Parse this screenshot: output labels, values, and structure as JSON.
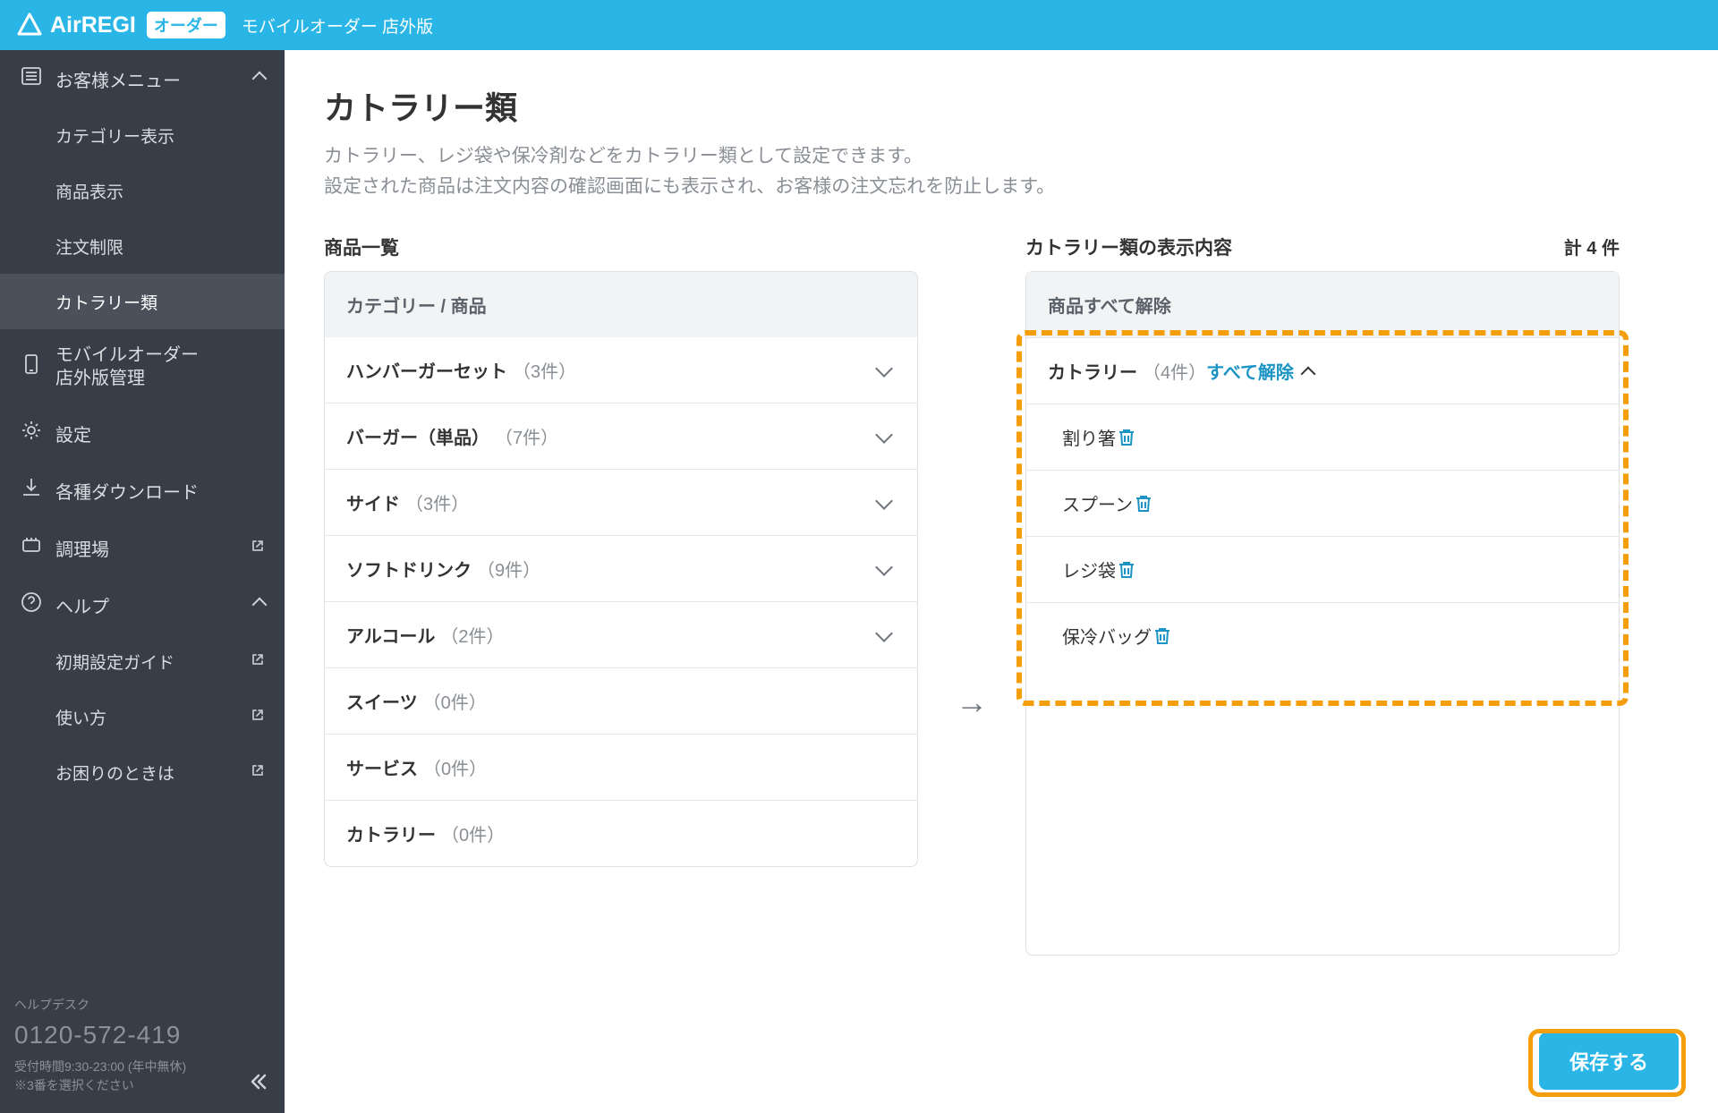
{
  "header": {
    "logo_text": "AirREGI",
    "logo_badge": "オーダー",
    "subtitle": "モバイルオーダー 店外版"
  },
  "sidebar": {
    "items": [
      {
        "label": "お客様メニュー",
        "icon": "menu-icon",
        "expandable": true
      },
      {
        "label": "カテゴリー表示",
        "sub": true
      },
      {
        "label": "商品表示",
        "sub": true
      },
      {
        "label": "注文制限",
        "sub": true
      },
      {
        "label": "カトラリー類",
        "sub": true,
        "active": true
      },
      {
        "label": "モバイルオーダー店外版管理",
        "icon": "mobile-icon",
        "multiline": true
      },
      {
        "label": "設定",
        "icon": "gear-icon"
      },
      {
        "label": "各種ダウンロード",
        "icon": "download-icon"
      },
      {
        "label": "調理場",
        "icon": "kitchen-icon",
        "ext": true
      },
      {
        "label": "ヘルプ",
        "icon": "help-icon",
        "expandable": true
      },
      {
        "label": "初期設定ガイド",
        "sub": true,
        "ext": true
      },
      {
        "label": "使い方",
        "sub": true,
        "ext": true
      },
      {
        "label": "お困りのときは",
        "sub": true,
        "ext": true
      }
    ],
    "footer": {
      "desk_label": "ヘルプデスク",
      "phone": "0120-572-419",
      "hours": "受付時間9:30-23:00 (年中無休)",
      "note": "※3番を選択ください"
    }
  },
  "page": {
    "title": "カトラリー類",
    "desc1": "カトラリー、レジ袋や保冷剤などをカトラリー類として設定できます。",
    "desc2": "設定された商品は注文内容の確認画面にも表示され、お客様の注文忘れを防止します。"
  },
  "left": {
    "heading": "商品一覧",
    "header_label": "カテゴリー / 商品",
    "categories": [
      {
        "name": "ハンバーガーセット",
        "count": "（3件）",
        "expandable": true
      },
      {
        "name": "バーガー（単品）",
        "count": "（7件）",
        "expandable": true
      },
      {
        "name": "サイド",
        "count": "（3件）",
        "expandable": true
      },
      {
        "name": "ソフトドリンク",
        "count": "（9件）",
        "expandable": true
      },
      {
        "name": "アルコール",
        "count": "（2件）",
        "expandable": true
      },
      {
        "name": "スイーツ",
        "count": "（0件）",
        "expandable": false
      },
      {
        "name": "サービス",
        "count": "（0件）",
        "expandable": false
      },
      {
        "name": "カトラリー",
        "count": "（0件）",
        "expandable": false
      }
    ]
  },
  "right": {
    "heading": "カトラリー類の表示内容",
    "total_label": "計 4 件",
    "header_label": "商品",
    "clear_all": "すべて解除",
    "group": {
      "name": "カトラリー",
      "count": "（4件）",
      "clear": "すべて解除"
    },
    "items": [
      {
        "name": "割り箸"
      },
      {
        "name": "スプーン"
      },
      {
        "name": "レジ袋"
      },
      {
        "name": "保冷バッグ"
      }
    ]
  },
  "save_label": "保存する"
}
